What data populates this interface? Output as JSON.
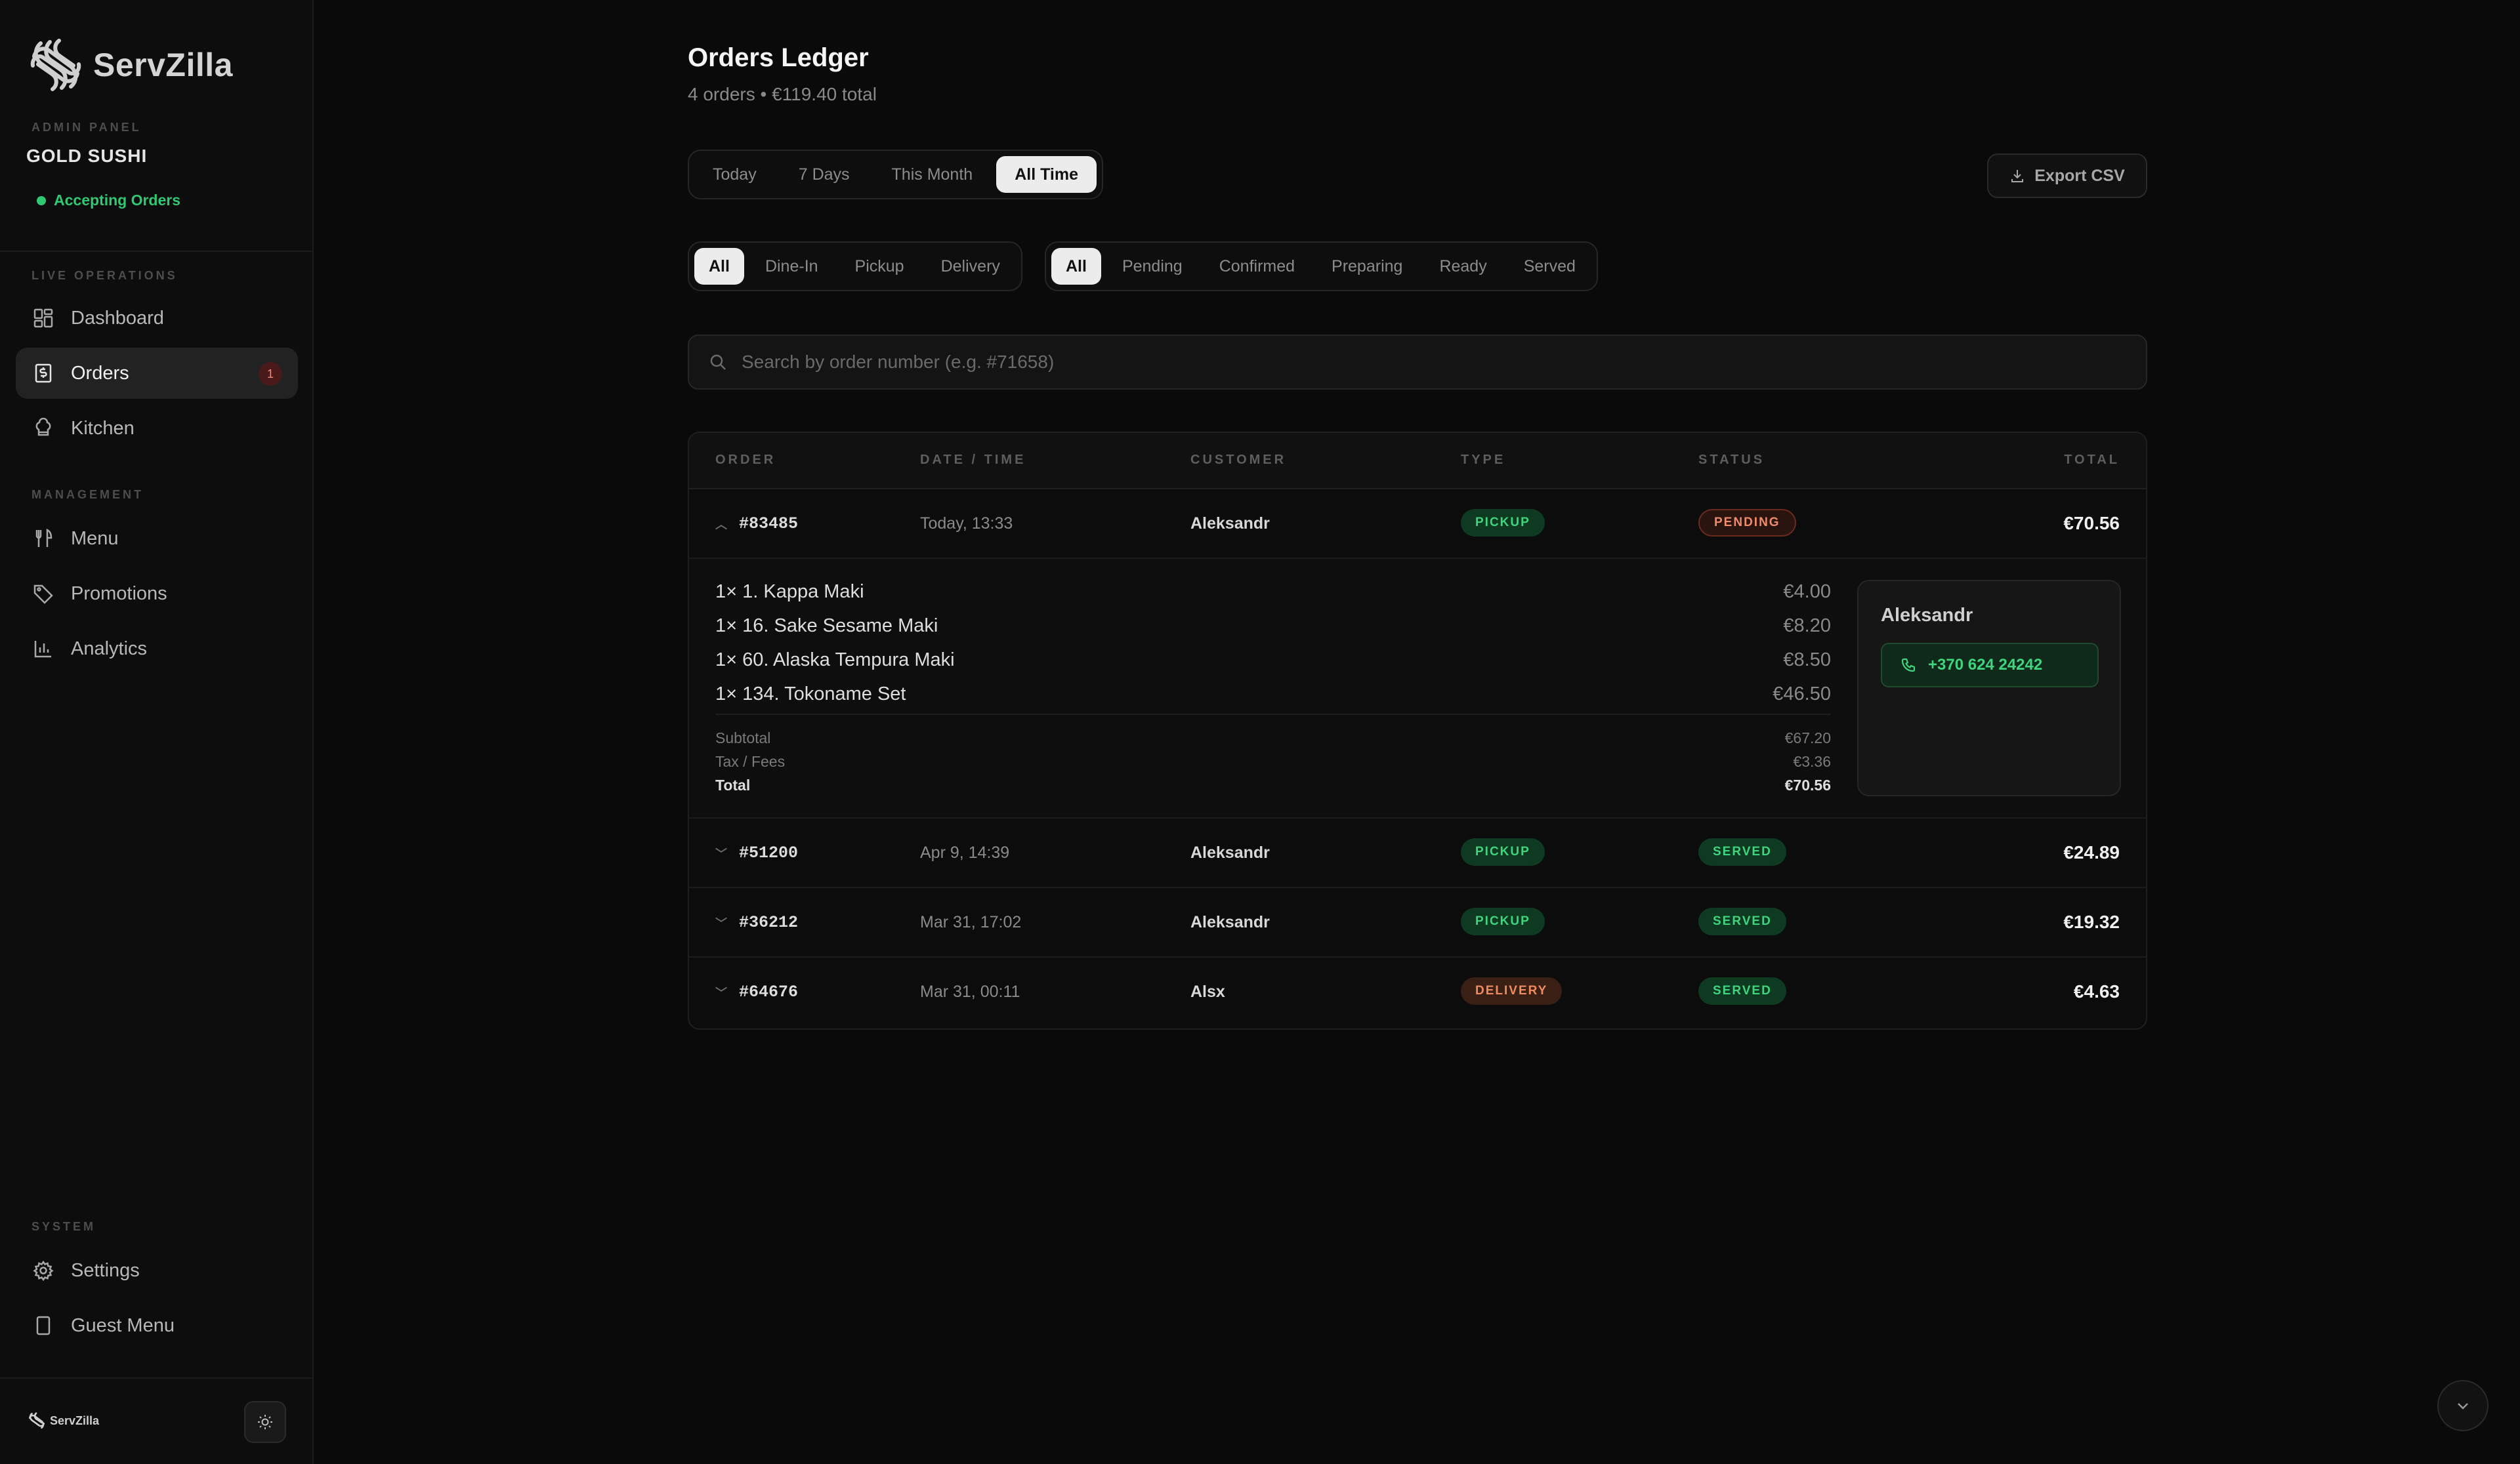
{
  "brand": {
    "name": "ServZilla",
    "footer_name": "ServZilla"
  },
  "sidebar": {
    "panel_label": "ADMIN PANEL",
    "restaurant": "GOLD SUSHI",
    "status": "Accepting Orders",
    "sections": {
      "live": "LIVE OPERATIONS",
      "management": "MANAGEMENT",
      "system": "SYSTEM"
    },
    "items": {
      "dashboard": "Dashboard",
      "orders": "Orders",
      "orders_badge": "1",
      "kitchen": "Kitchen",
      "menu": "Menu",
      "promotions": "Promotions",
      "analytics": "Analytics",
      "settings": "Settings",
      "guest_menu": "Guest Menu"
    }
  },
  "header": {
    "title": "Orders Ledger",
    "subtitle": "4 orders • €119.40 total",
    "export_label": "Export CSV"
  },
  "filters": {
    "range": [
      "Today",
      "7 Days",
      "This Month",
      "All Time"
    ],
    "range_active": "All Time",
    "type": [
      "All",
      "Dine-In",
      "Pickup",
      "Delivery"
    ],
    "type_active": "All",
    "status": [
      "All",
      "Pending",
      "Confirmed",
      "Preparing",
      "Ready",
      "Served"
    ],
    "status_active": "All"
  },
  "search": {
    "placeholder": "Search by order number (e.g. #71658)",
    "value": ""
  },
  "table": {
    "headers": [
      "ORDER",
      "DATE / TIME",
      "CUSTOMER",
      "TYPE",
      "STATUS",
      "TOTAL"
    ],
    "rows": [
      {
        "order": "#83485",
        "date": "Today, 13:33",
        "customer": "Aleksandr",
        "type": "PICKUP",
        "status": "PENDING",
        "total": "€70.56",
        "expanded": true
      },
      {
        "order": "#51200",
        "date": "Apr 9, 14:39",
        "customer": "Aleksandr",
        "type": "PICKUP",
        "status": "SERVED",
        "total": "€24.89",
        "expanded": false
      },
      {
        "order": "#36212",
        "date": "Mar 31, 17:02",
        "customer": "Aleksandr",
        "type": "PICKUP",
        "status": "SERVED",
        "total": "€19.32",
        "expanded": false
      },
      {
        "order": "#64676",
        "date": "Mar 31, 00:11",
        "customer": "Alsx",
        "type": "DELIVERY",
        "status": "SERVED",
        "total": "€4.63",
        "expanded": false
      }
    ]
  },
  "detail": {
    "items": [
      {
        "label": "1× 1. Kappa Maki",
        "price": "€4.00"
      },
      {
        "label": "1× 16. Sake Sesame Maki",
        "price": "€8.20"
      },
      {
        "label": "1× 60. Alaska Tempura Maki",
        "price": "€8.50"
      },
      {
        "label": "1× 134. Tokoname Set",
        "price": "€46.50"
      }
    ],
    "subtotal_label": "Subtotal",
    "subtotal": "€67.20",
    "tax_label": "Tax / Fees",
    "tax": "€3.36",
    "total_label": "Total",
    "total": "€70.56",
    "customer_name": "Aleksandr",
    "phone": "+370 624 24242"
  },
  "colors": {
    "accent_green": "#3ed57e",
    "pending_orange": "#f08b6a",
    "background": "#0a0a0a"
  }
}
